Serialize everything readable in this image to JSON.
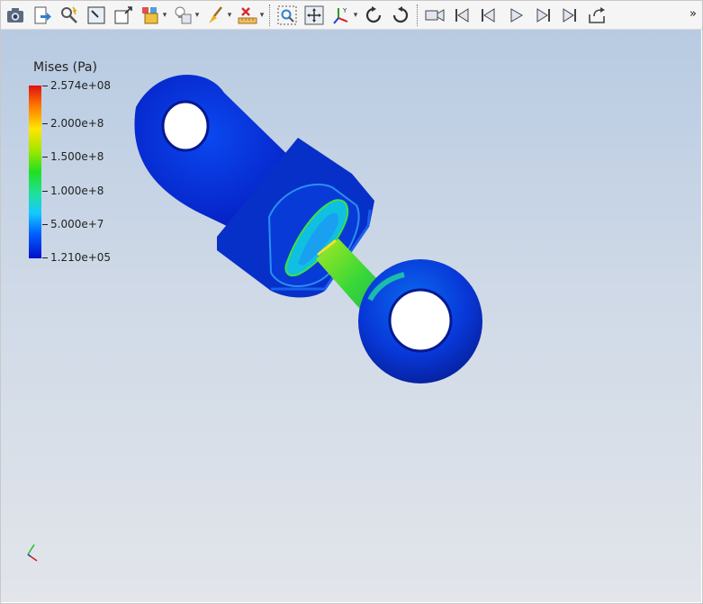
{
  "toolbar": {
    "buttons": [
      {
        "icon": "camera-icon"
      },
      {
        "icon": "export-icon"
      },
      {
        "icon": "pick-center-icon"
      },
      {
        "icon": "select-cells-icon"
      },
      {
        "icon": "select-points-icon"
      },
      {
        "icon": "representation-icon"
      },
      {
        "icon": "light-icon"
      },
      {
        "icon": "color-brush-icon"
      },
      {
        "icon": "ruler-icon"
      },
      {
        "icon": "zoom-to-box-icon"
      },
      {
        "icon": "reset-camera-icon"
      },
      {
        "icon": "axes-orientation-icon"
      },
      {
        "icon": "rotate-cw-icon"
      },
      {
        "icon": "rotate-ccw-icon"
      },
      {
        "icon": "video-camera-icon"
      },
      {
        "icon": "first-frame-icon"
      },
      {
        "icon": "previous-frame-icon"
      },
      {
        "icon": "play-icon"
      },
      {
        "icon": "next-frame-icon"
      },
      {
        "icon": "last-frame-icon"
      },
      {
        "icon": "loop-icon"
      }
    ],
    "more": "»"
  },
  "legend": {
    "title": "Mises (Pa)",
    "ticks": [
      "2.574e+08",
      "2.000e+8",
      "1.500e+8",
      "1.000e+8",
      "5.000e+7",
      "1.210e+05"
    ],
    "colors": {
      "max": "#e01010",
      "min": "#0010c8"
    }
  }
}
